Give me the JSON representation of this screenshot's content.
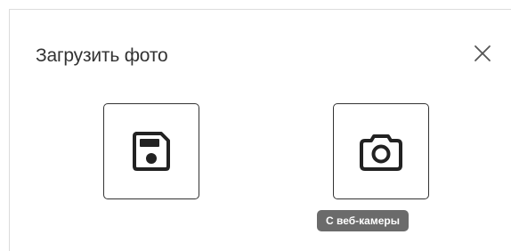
{
  "dialog": {
    "title": "Загрузить фото",
    "close_icon": "close-icon"
  },
  "options": [
    {
      "name": "upload-from-file",
      "icon": "floppy-disk-icon"
    },
    {
      "name": "upload-from-webcam",
      "icon": "camera-icon"
    }
  ],
  "tooltip": {
    "text": "С веб-камеры"
  },
  "colors": {
    "text": "#333333",
    "border": "#333333",
    "tooltip_bg": "#6b6b6b",
    "tooltip_text": "#ffffff",
    "icon": "#222222"
  }
}
